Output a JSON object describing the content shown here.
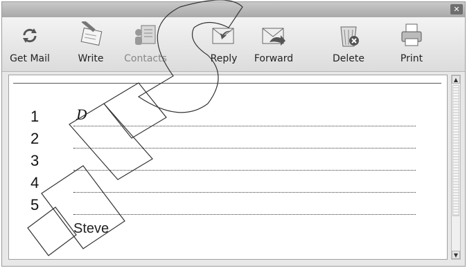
{
  "window": {
    "close_symbol": "✕"
  },
  "toolbar": {
    "items": [
      {
        "label": "Get Mail",
        "icon": "get-mail-icon"
      },
      {
        "label": "Write",
        "icon": "write-icon"
      },
      {
        "label": "Contacts",
        "icon": "contacts-icon"
      },
      {
        "label": "Reply",
        "icon": "reply-icon"
      },
      {
        "label": "Forward",
        "icon": "forward-icon"
      },
      {
        "label": "Delete",
        "icon": "delete-icon"
      },
      {
        "label": "Print",
        "icon": "print-icon"
      }
    ]
  },
  "message": {
    "lines": [
      {
        "number": "1",
        "answer": "D"
      },
      {
        "number": "2",
        "answer": ""
      },
      {
        "number": "3",
        "answer": ""
      },
      {
        "number": "4",
        "answer": ""
      },
      {
        "number": "5",
        "answer": ""
      }
    ],
    "signoff": "Steve"
  },
  "scrollbar": {
    "up_symbol": "▲",
    "down_symbol": "▼"
  }
}
